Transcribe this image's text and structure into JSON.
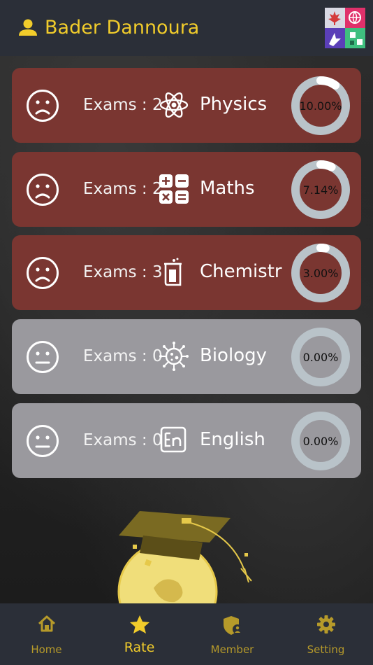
{
  "header": {
    "user_name": "Bader Dannoura",
    "user_icon": "person-icon",
    "logo_icon": "app-logo-icon"
  },
  "subjects": [
    {
      "face_icon": "sad-face-icon",
      "exams": "Exams : 2",
      "icon": "atom-icon",
      "name": "Physics",
      "percent_label": "10.00%",
      "percent": 10.0,
      "status": "active"
    },
    {
      "face_icon": "sad-face-icon",
      "exams": "Exams : 2",
      "icon": "calculator-icon",
      "name": "Maths",
      "percent_label": "7.14%",
      "percent": 7.14,
      "status": "active"
    },
    {
      "face_icon": "sad-face-icon",
      "exams": "Exams : 3",
      "icon": "beaker-icon",
      "name": "Chemistr",
      "percent_label": "3.00%",
      "percent": 3.0,
      "status": "active"
    },
    {
      "face_icon": "neutral-face-icon",
      "exams": "Exams : 0",
      "icon": "virus-icon",
      "name": "Biology",
      "percent_label": "0.00%",
      "percent": 0.0,
      "status": "inactive"
    },
    {
      "face_icon": "neutral-face-icon",
      "exams": "Exams : 0",
      "icon": "en-icon",
      "name": "English",
      "percent_label": "0.00%",
      "percent": 0.0,
      "status": "inactive"
    }
  ],
  "nav": [
    {
      "label": "Home",
      "icon": "home-icon"
    },
    {
      "label": "Rate",
      "icon": "star-icon",
      "selected": true
    },
    {
      "label": "Member",
      "icon": "shield-user-icon"
    },
    {
      "label": "Setting",
      "icon": "gear-icon"
    }
  ],
  "colors": {
    "accent": "#f1cc2b",
    "active_card": "#7a3631",
    "inactive_card": "#9a999e",
    "ring_track": "#b9c3c9",
    "ring_fill": "#ffffff",
    "bar_bg": "#2b2f38"
  }
}
